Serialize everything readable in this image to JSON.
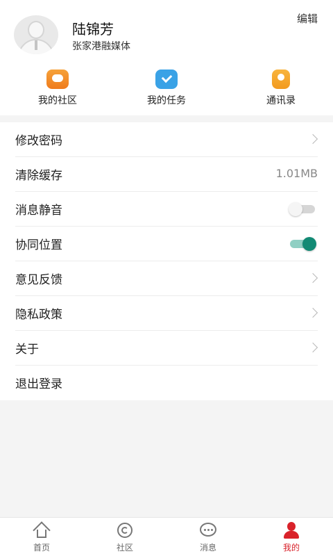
{
  "profile": {
    "name": "陆锦芳",
    "organization": "张家港融媒体",
    "edit_label": "编辑"
  },
  "shortcuts": [
    {
      "label": "我的社区",
      "icon": "community-chat-icon",
      "color": "#f08a26"
    },
    {
      "label": "我的任务",
      "icon": "task-check-icon",
      "color": "#3aa2e6"
    },
    {
      "label": "通讯录",
      "icon": "contacts-book-icon",
      "color": "#f5a82e"
    }
  ],
  "settings": [
    {
      "label": "修改密码",
      "control": "chevron"
    },
    {
      "label": "清除缓存",
      "control": "value",
      "value": "1.01MB"
    },
    {
      "label": "消息静音",
      "control": "toggle",
      "on": false
    },
    {
      "label": "协同位置",
      "control": "toggle",
      "on": true
    },
    {
      "label": "意见反馈",
      "control": "chevron"
    },
    {
      "label": "隐私政策",
      "control": "chevron"
    },
    {
      "label": "关于",
      "control": "chevron"
    },
    {
      "label": "退出登录",
      "control": "none"
    }
  ],
  "bottom_nav": [
    {
      "label": "首页",
      "icon": "home-icon",
      "active": false
    },
    {
      "label": "社区",
      "icon": "community-icon",
      "active": false
    },
    {
      "label": "消息",
      "icon": "message-icon",
      "active": false
    },
    {
      "label": "我的",
      "icon": "profile-icon",
      "active": true
    }
  ],
  "colors": {
    "accent": "#d9222a",
    "toggle_on": "#128a74",
    "background": "#f4f4f4"
  }
}
